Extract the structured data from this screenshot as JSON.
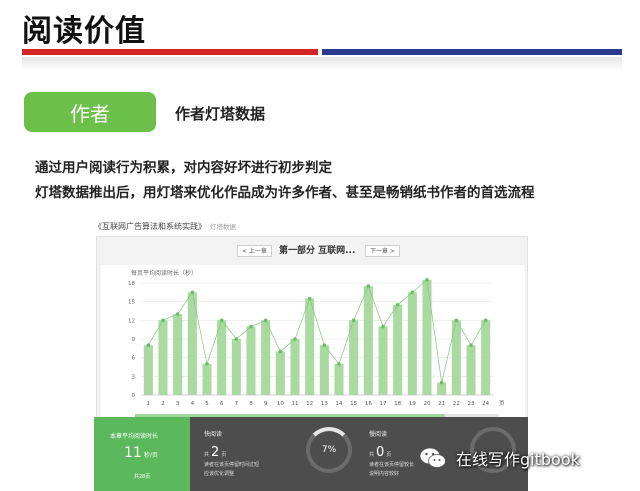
{
  "page": {
    "title": "阅读价值",
    "author_button": "作者",
    "subtitle": "作者灯塔数据",
    "paragraphs": [
      "通过用户阅读行为积累，对内容好坏进行初步判定",
      "灯塔数据推出后，用灯塔来优化作品成为许多作者、甚至是畅销纸书作者的首选流程"
    ],
    "header_colors": {
      "left": "#d42424",
      "right": "#2b3a8f"
    },
    "accent": "#6cc04a"
  },
  "embedded": {
    "book_title": "《互联网广告算法和系统实践》",
    "book_subtitle": "灯塔数据",
    "prev_button": "< 上一章",
    "chapter_title": "第一部分 互联网...",
    "next_button": "下一章 >",
    "stats": {
      "avg_label": "本章平均阅读时长",
      "avg_value": "11",
      "avg_unit": "秒/页",
      "avg_footer": "共28页",
      "fast_label": "快阅读",
      "fast_prefix": "共",
      "fast_count": "2",
      "fast_suffix": "页",
      "fast_desc_1": "读者在该页停留时间过短",
      "fast_desc_2": "应该优化调整",
      "fast_percent": "7%",
      "slow_label": "慢阅读",
      "slow_prefix": "共",
      "slow_count": "0",
      "slow_suffix": "页",
      "slow_desc_1": "读者在该页停留较长",
      "slow_desc_2": "说明内容较好"
    }
  },
  "watermark": {
    "text": "在线写作gitbook",
    "icon": "wechat-icon"
  },
  "chart_data": {
    "type": "bar",
    "title": "每页平均阅读时长（秒）",
    "x_unit": "页",
    "categories": [
      "1",
      "2",
      "3",
      "4",
      "5",
      "6",
      "7",
      "8",
      "9",
      "10",
      "11",
      "12",
      "13",
      "14",
      "15",
      "16",
      "17",
      "18",
      "19",
      "20",
      "21",
      "22",
      "23",
      "24"
    ],
    "values": [
      8,
      12,
      13,
      16.5,
      5,
      12,
      9,
      11,
      12,
      7,
      9,
      15.5,
      8,
      5,
      12,
      17.5,
      11,
      14.5,
      16.5,
      18.5,
      2,
      12,
      8,
      12
    ],
    "ylim": [
      0,
      18
    ],
    "yticks": [
      0,
      3,
      6,
      9,
      12,
      15,
      18
    ],
    "overlay": "line",
    "grid": true,
    "bar_color": "#a9dba1",
    "line_color": "#7fc879"
  }
}
